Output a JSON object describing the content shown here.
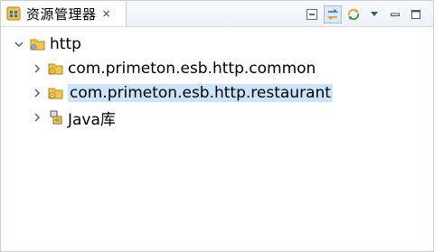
{
  "view": {
    "title": "资源管理器",
    "close_glyph": "×",
    "toolbar": [
      {
        "name": "collapse-all-icon"
      },
      {
        "name": "link-with-editor-icon",
        "active": true
      },
      {
        "name": "sync-icon"
      },
      {
        "name": "view-menu-icon"
      },
      {
        "name": "minimize-icon"
      },
      {
        "name": "maximize-icon"
      }
    ]
  },
  "tree": {
    "root": {
      "label": "http",
      "expanded": true,
      "icon": "project-folder-icon"
    },
    "children": [
      {
        "label": "com.primeton.esb.http.common",
        "icon": "module-folder-icon",
        "expanded": false,
        "selected": false
      },
      {
        "label": "com.primeton.esb.http.restaurant",
        "icon": "module-folder-icon",
        "expanded": false,
        "selected": true
      },
      {
        "label": "Java库",
        "icon": "java-library-icon",
        "expanded": false,
        "selected": false
      }
    ]
  },
  "colors": {
    "selection": "#cce4fa",
    "active_tool_bg": "#dbe9fb",
    "folder": "#f3c64b",
    "border": "#c9cdd4"
  }
}
